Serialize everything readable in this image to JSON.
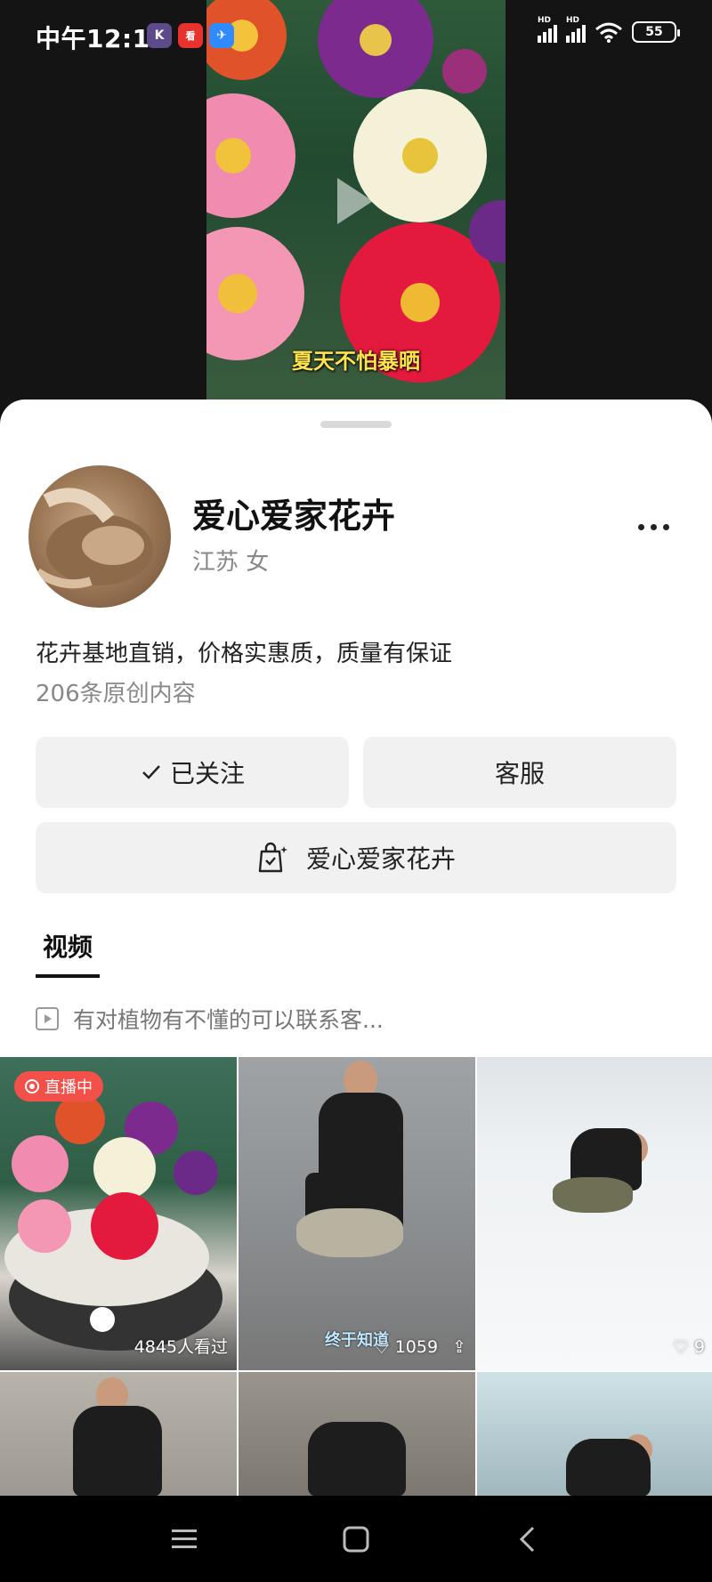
{
  "status_bar": {
    "time": "中午12:15",
    "app_icons": [
      "k-app-icon",
      "news-app-icon",
      "browser-app-icon"
    ],
    "signal1_label": "HD",
    "signal2_label": "HD",
    "battery": "55"
  },
  "video_preview": {
    "caption": "夏天不怕暴晒"
  },
  "profile": {
    "name": "爱心爱家花卉",
    "location_gender": "江苏 女",
    "bio": "花卉基地直销，价格实惠质，质量有保证",
    "content_count": "206条原创内容"
  },
  "actions": {
    "follow_label": "已关注",
    "service_label": "客服",
    "shop_label": "爱心爱家花卉"
  },
  "tabs": {
    "active": "视频"
  },
  "playlist": {
    "title": "有对植物有不懂的可以联系客..."
  },
  "grid": {
    "items": [
      {
        "badge": "直播中",
        "stat": "4845人看过"
      },
      {
        "caption": "终于知道",
        "likes": "1059"
      },
      {
        "likes": "9"
      },
      {},
      {},
      {}
    ]
  },
  "colors": {
    "live_badge": "#f4504a",
    "caption_yellow": "#ffe34d"
  }
}
